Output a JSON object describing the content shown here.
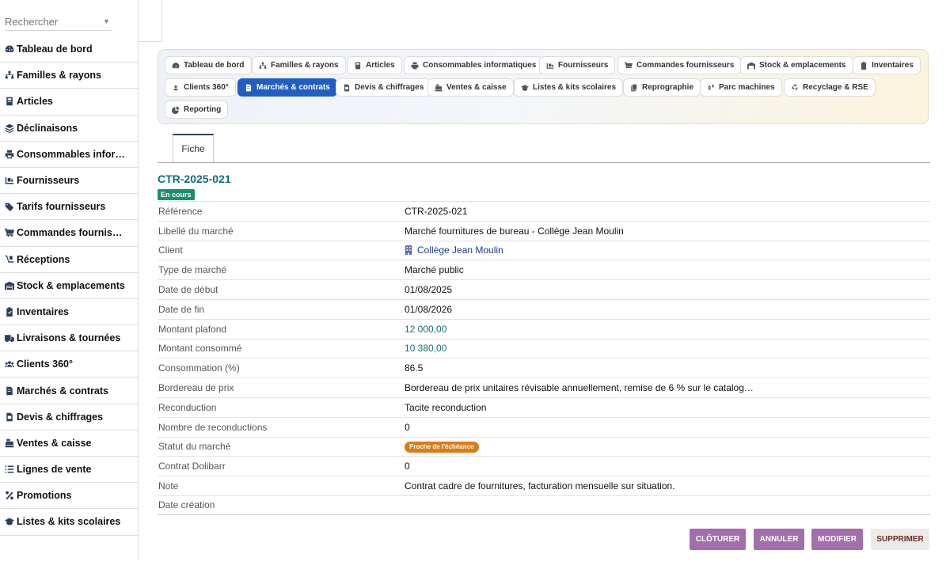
{
  "search": {
    "placeholder": "Rechercher"
  },
  "sidebar": {
    "items": [
      {
        "label": "Tableau de bord"
      },
      {
        "label": "Familles & rayons"
      },
      {
        "label": "Articles"
      },
      {
        "label": "Déclinaisons"
      },
      {
        "label": "Consommables infor…"
      },
      {
        "label": "Fournisseurs"
      },
      {
        "label": "Tarifs fournisseurs"
      },
      {
        "label": "Commandes fournis…"
      },
      {
        "label": "Réceptions"
      },
      {
        "label": "Stock & emplacements"
      },
      {
        "label": "Inventaires"
      },
      {
        "label": "Livraisons & tournées"
      },
      {
        "label": "Clients 360°"
      },
      {
        "label": "Marchés & contrats"
      },
      {
        "label": "Devis & chiffrages"
      },
      {
        "label": "Ventes & caisse"
      },
      {
        "label": "Lignes de vente"
      },
      {
        "label": "Promotions"
      },
      {
        "label": "Listes & kits scolaires"
      }
    ]
  },
  "tabs": {
    "items": [
      {
        "label": "Tableau de bord"
      },
      {
        "label": "Familles & rayons"
      },
      {
        "label": "Articles"
      },
      {
        "label": "Consommables informatiques"
      },
      {
        "label": "Fournisseurs"
      },
      {
        "label": "Commandes fournisseurs"
      },
      {
        "label": "Stock & emplacements"
      },
      {
        "label": "Inventaires"
      },
      {
        "label": "Clients 360°"
      },
      {
        "label": "Marchés & contrats"
      },
      {
        "label": "Devis & chiffrages"
      },
      {
        "label": "Ventes & caisse"
      },
      {
        "label": "Listes & kits scolaires"
      },
      {
        "label": "Reprographie"
      },
      {
        "label": "Parc machines"
      },
      {
        "label": "Recyclage & RSE"
      },
      {
        "label": "Reporting"
      }
    ],
    "active": "Marchés & contrats"
  },
  "record": {
    "tab_label": "Fiche",
    "title": "CTR-2025-021",
    "status": "En cours",
    "fields": [
      {
        "label": "Référence",
        "value": "CTR-2025-021"
      },
      {
        "label": "Libellé du marché",
        "value": "Marché fournitures de bureau - Collège Jean Moulin"
      },
      {
        "label": "Client",
        "value": "Collège Jean Moulin"
      },
      {
        "label": "Type de marché",
        "value": "Marché public"
      },
      {
        "label": "Date de début",
        "value": "01/08/2025"
      },
      {
        "label": "Date de fin",
        "value": "01/08/2026"
      },
      {
        "label": "Montant plafond",
        "value": "12 000,00"
      },
      {
        "label": "Montant consommé",
        "value": "10 380,00"
      },
      {
        "label": "Consommation (%)",
        "value": "86.5"
      },
      {
        "label": "Bordereau de prix",
        "value": "Bordereau de prix unitaires révisable annuellement, remise de 6 % sur le catalog…"
      },
      {
        "label": "Reconduction",
        "value": "Tacite reconduction"
      },
      {
        "label": "Nombre de reconductions",
        "value": "0"
      },
      {
        "label": "Statut du marché",
        "value": "Proche de l'échéance"
      },
      {
        "label": "Contrat Dolibarr",
        "value": "0"
      },
      {
        "label": "Note",
        "value": "Contrat cadre de fournitures, facturation mensuelle sur situation."
      },
      {
        "label": "Date création",
        "value": ""
      }
    ]
  },
  "actions": {
    "close": "CLÔTURER",
    "cancel": "ANNULER",
    "edit": "MODIFIER",
    "delete": "SUPPRIMER"
  },
  "colors": {
    "accent": "#1f5fc4",
    "title": "#0f6e7d",
    "status_ok": "#1a8f6e",
    "status_warn": "#dd7b14",
    "button": "#a26eab"
  }
}
